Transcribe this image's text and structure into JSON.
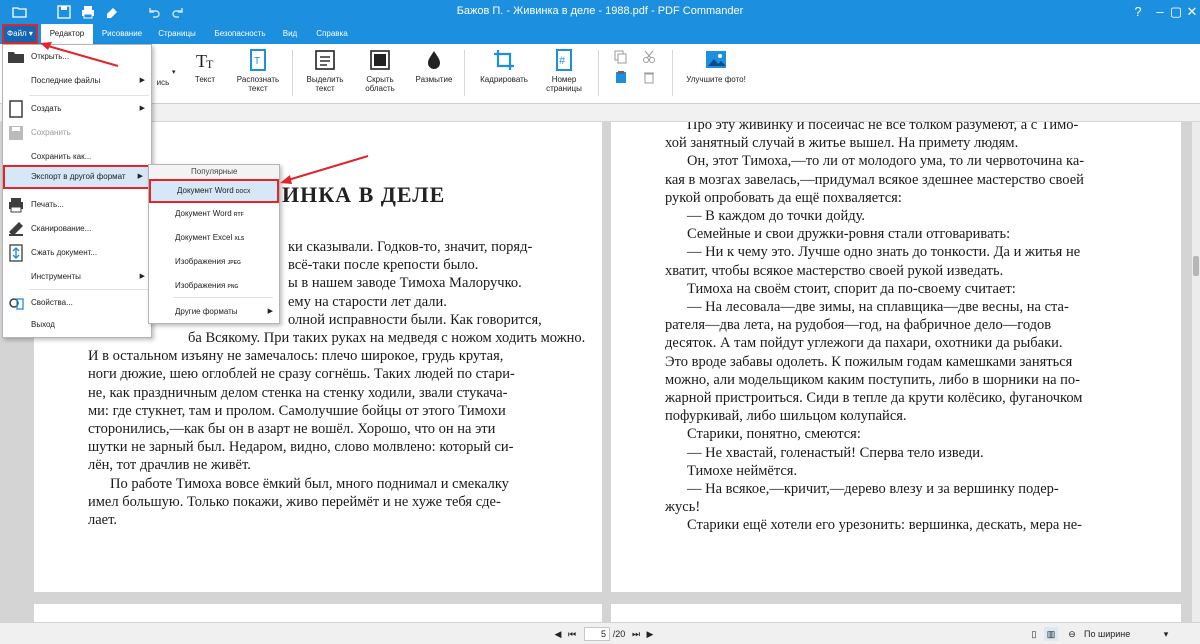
{
  "window": {
    "title": "Бажов П. - Живинка в деле - 1988.pdf - PDF Commander",
    "colors": {
      "accent": "#1c8fde",
      "highlight": "#e0262b"
    }
  },
  "quick_access": [
    "open-icon",
    "save-icon",
    "print-icon",
    "eraser-icon",
    "undo-icon",
    "redo-icon"
  ],
  "menu_tabs": {
    "file": "Файл",
    "editor": "Редактор",
    "drawing": "Рисование",
    "pages": "Страницы",
    "security": "Безопасность",
    "view": "Вид",
    "help": "Справка"
  },
  "ribbon": {
    "write_partial": "ись",
    "text": "Текст",
    "recognize": "Распознать текст",
    "select_text": "Выделить текст",
    "hide_area": "Скрыть область",
    "blur": "Размытие",
    "crop": "Кадрировать",
    "page_number": "Номер страницы",
    "improve_photo": "Улучшите фото!"
  },
  "file_menu": {
    "open": "Открыть...",
    "recent": "Последние файлы",
    "create": "Создать",
    "save": "Сохранить",
    "save_as": "Сохранить как...",
    "export": "Экспорт в другой формат",
    "print": "Печать...",
    "scan": "Сканирование...",
    "compress": "Сжать документ...",
    "tools": "Инструменты",
    "properties": "Свойства...",
    "exit": "Выход"
  },
  "export_submenu": {
    "popular": "Популярные",
    "items": [
      {
        "label": "Документ Word",
        "ext": "DOCX"
      },
      {
        "label": "Документ Word",
        "ext": "RTF"
      },
      {
        "label": "Документ Excel",
        "ext": "XLS"
      },
      {
        "label": "Изображения",
        "ext": "JPEG"
      },
      {
        "label": "Изображения",
        "ext": "PNG"
      }
    ],
    "other": "Другие форматы"
  },
  "document": {
    "left_heading": "ИНКА В ДЕЛЕ",
    "left_lines": [
      "ки сказывали. Годков-то, значит, поряд-",
      "всё-таки после крепости было.",
      "ы в нашем заводе Тимоха Малоручко.",
      "ему на старости лет дали.",
      "олной исправности были. Как говорится,",
      "ба Всякому. При таких руках на медведя с ножом ходить можно.",
      "И в остальном изъяну не замечалось: плечо широкое, грудь крутая,",
      "ноги дюжие, шею оглоблей не сразу согнёшь. Таких людей по стари-",
      "не, как праздничным делом стенка на стенку ходили, звали стукача-",
      "ми: где стукнет, там и пролом. Самолучшие бойцы от этого Тимохи",
      "сторонились,—как бы он в азарт не вошёл. Хорошо, что он на эти",
      "шутки не зарный был. Недаром, видно, слово молвлено: который си-",
      "лён, тот драчлив не живёт.",
      "По работе Тимоха вовсе ёмкий был, много поднимал и смекалку",
      "имел большую. Только покажи, живо переймёт и не хуже тебя сде-",
      "лает."
    ],
    "right_lines": [
      "Про эту живинку и посейчас не все толком разумеют, а с Тимо-",
      "хой занятный случай в житье вышел. На примету людям.",
      "Он, этот Тимоха,—то ли от молодого ума, то ли червоточина ка-",
      "кая в мозгах завелась,—придумал всякое здешнее мастерство своей",
      "рукой опробовать да ещё похваляется:",
      "— В каждом до точки дойду.",
      "Семейные и свои дружки-ровня стали отговаривать:",
      "— Ни к чему это. Лучше одно знать до тонкости. Да и житья не",
      "хватит, чтобы всякое мастерство своей рукой изведать.",
      "Тимоха на своём стоит, спорит да по-своему считает:",
      "— На лесовала—две зимы, на сплавщика—две весны, на ста-",
      "рателя—два лета, на рудобоя—год, на фабричное дело—годов",
      "десяток. А там пойдут углежоги да пахари, охотники да рыбаки.",
      "Это вроде забавы одолеть. К пожилым годам камешками заняться",
      "можно, али модельщиком каким поступить, либо в шорники на по-",
      "жарной пристроиться. Сиди в тепле да крути колёсико, фуганочком",
      "пофуркивай, либо шильцом колупайся.",
      "Старики, понятно, смеются:",
      "— Не хвастай, голенастый! Сперва тело изведи.",
      "Тимохе неймётся.",
      "— На всякое,—кричит,—дерево влезу и за вершинку подер-",
      "жусь!",
      "Старики ещё хотели его урезонить: вершинка, дескать, мера не-"
    ]
  },
  "statusbar": {
    "page_current": "5",
    "page_total": "/20",
    "zoom_mode": "По ширине"
  }
}
